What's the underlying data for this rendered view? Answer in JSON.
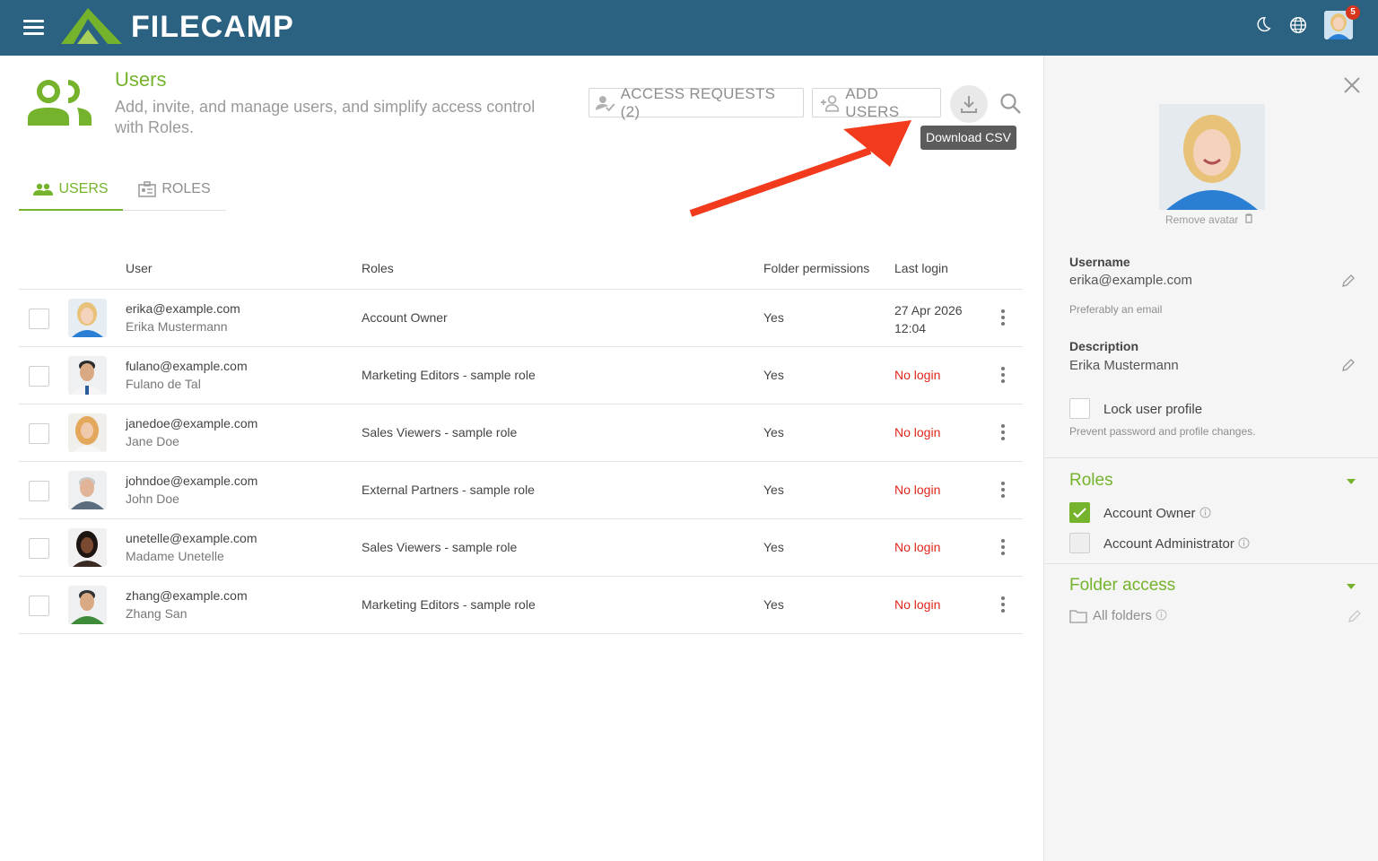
{
  "app": {
    "name": "FILECAMP",
    "notification_count": "5"
  },
  "header": {
    "title": "Users",
    "subtitle": "Add, invite, and manage users, and simplify access control with Roles.",
    "access_requests_label": "ACCESS REQUESTS (2)",
    "add_users_label": "ADD USERS",
    "download_tooltip": "Download CSV"
  },
  "tabs": [
    {
      "label": "USERS",
      "active": true
    },
    {
      "label": "ROLES",
      "active": false
    }
  ],
  "table": {
    "columns": [
      "User",
      "Roles",
      "Folder permissions",
      "Last login"
    ],
    "rows": [
      {
        "email": "erika@example.com",
        "name": "Erika Mustermann",
        "role": "Account Owner",
        "permissions": "Yes",
        "last_login_date": "27 Apr 2026",
        "last_login_time": "12:04"
      },
      {
        "email": "fulano@example.com",
        "name": "Fulano de Tal",
        "role": "Marketing Editors - sample role",
        "permissions": "Yes",
        "last_login": "No login"
      },
      {
        "email": "janedoe@example.com",
        "name": "Jane Doe",
        "role": "Sales Viewers - sample role",
        "permissions": "Yes",
        "last_login": "No login"
      },
      {
        "email": "johndoe@example.com",
        "name": "John Doe",
        "role": "External Partners - sample role",
        "permissions": "Yes",
        "last_login": "No login"
      },
      {
        "email": "unetelle@example.com",
        "name": "Madame Unetelle",
        "role": "Sales Viewers - sample role",
        "permissions": "Yes",
        "last_login": "No login"
      },
      {
        "email": "zhang@example.com",
        "name": "Zhang San",
        "role": "Marketing Editors - sample role",
        "permissions": "Yes",
        "last_login": "No login"
      }
    ]
  },
  "side_panel": {
    "remove_avatar_label": "Remove avatar",
    "username_label": "Username",
    "username_value": "erika@example.com",
    "username_hint": "Preferably an email",
    "description_label": "Description",
    "description_value": "Erika Mustermann",
    "lock_label": "Lock user profile",
    "lock_hint": "Prevent password and profile changes.",
    "roles_title": "Roles",
    "roles": [
      {
        "label": "Account Owner",
        "checked": true
      },
      {
        "label": "Account Administrator",
        "checked": false
      }
    ],
    "folder_access_title": "Folder access",
    "folder_label": "All folders"
  },
  "colors": {
    "brand_green": "#74b32b",
    "topbar": "#2b6281",
    "no_login_red": "#e0271b",
    "annotation_arrow": "#f23a1d"
  },
  "icons": [
    "menu-icon",
    "filecamp-logo",
    "moon-icon",
    "globe-icon",
    "users-icon",
    "user-check-icon",
    "add-user-icon",
    "download-icon",
    "search-icon",
    "close-icon",
    "pencil-icon",
    "trash-icon",
    "info-icon",
    "folder-icon",
    "kebab-icon"
  ]
}
